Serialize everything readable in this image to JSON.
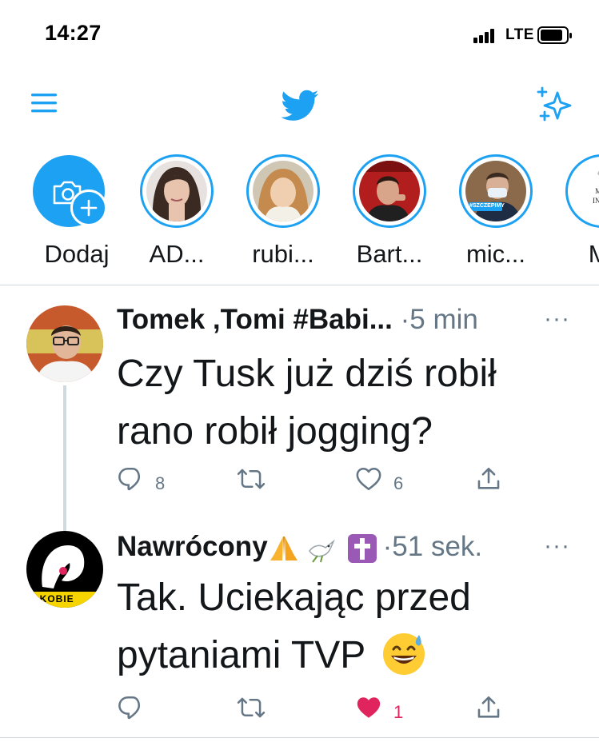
{
  "status_bar": {
    "time": "14:27",
    "network": "LTE"
  },
  "nav": {
    "menu_icon": "hamburger-menu-icon",
    "logo_icon": "twitter-bird-icon",
    "sparkle_icon": "top-tweets-sparkle-icon",
    "accent_color": "#1da1f2"
  },
  "fleets": [
    {
      "label": "Dodaj",
      "type": "add"
    },
    {
      "label": "AD..."
    },
    {
      "label": "rubi..."
    },
    {
      "label": "Bart..."
    },
    {
      "label": "mic...",
      "badge": "#SZCZEPIMY"
    },
    {
      "label": "MI",
      "logo_text": "MINIS INFRAS"
    }
  ],
  "tweets": [
    {
      "name": "Tomek ,Tomi #Babi...",
      "time": "·5 min",
      "more": "···",
      "text_line1": "Czy Tusk już dziś robił",
      "text_line2": "rano robił jogging?",
      "replies": "8",
      "retweets": "",
      "likes": "6",
      "liked": false
    },
    {
      "name": "Nawrócony",
      "name_emojis": [
        "folded-hands-emoji",
        "dove-emoji",
        "latin-cross-emoji"
      ],
      "time": "·51 sek.",
      "more": "···",
      "avatar_text": "O KOBIE",
      "text_line1": "Tak. Uciekając przed",
      "text_line2": "pytaniami TVP",
      "text_emoji": "grinning-sweat-emoji",
      "replies": "",
      "retweets": "",
      "likes": "1",
      "liked": true,
      "like_color": "#e0245e"
    }
  ]
}
